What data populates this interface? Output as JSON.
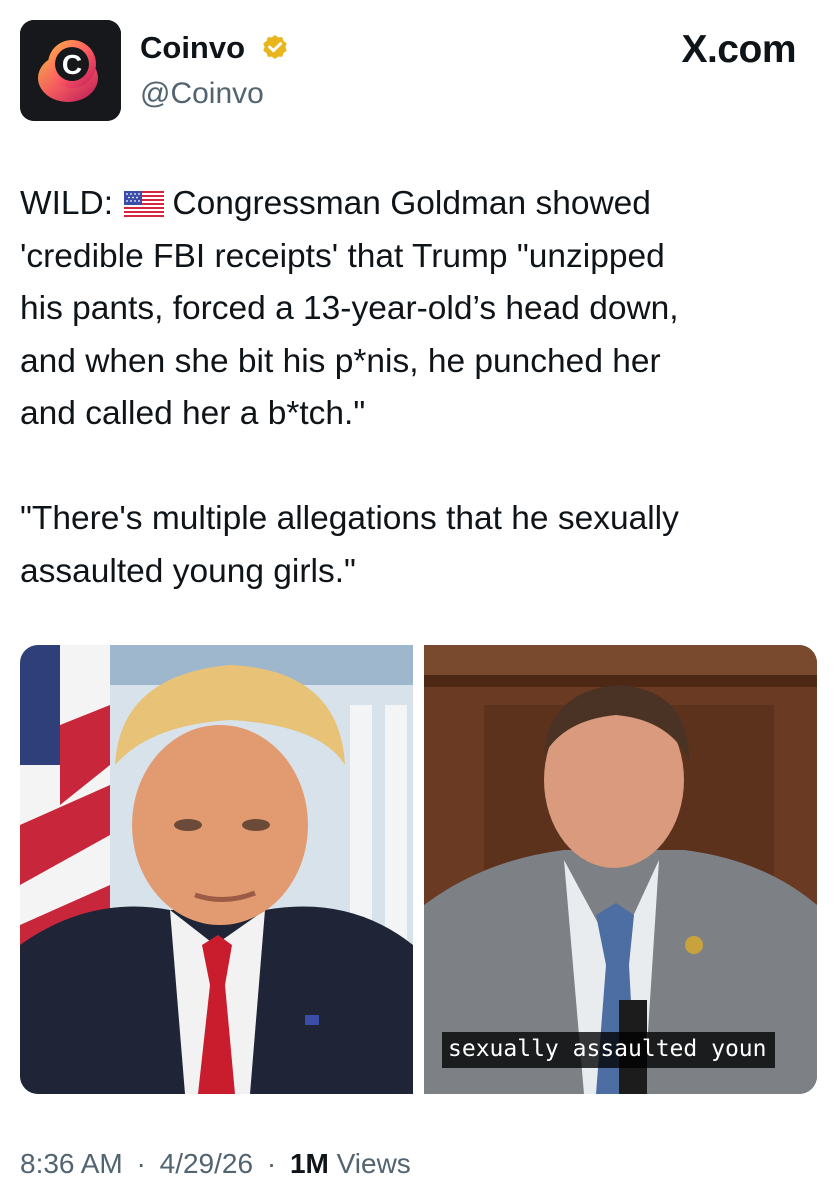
{
  "author": {
    "name": "Coinvo",
    "handle": "@Coinvo",
    "avatar_letter": "C",
    "verified_color": "#e8b51d"
  },
  "site_label": "X.com",
  "tweet": {
    "text_part1": "WILD: ",
    "flag_icon": "us-flag-icon",
    "text_part2": "Congressman Goldman showed\n'credible FBI receipts' that Trump \"unzipped\nhis pants, forced a 13-year-old’s head down,\nand when she bit his p*nis, he punched her\nand called her a b*tch.\"\n\n\"There's multiple allegations that he sexually\nassaulted young girls.\""
  },
  "media": {
    "right_caption": "sexually assaulted youn"
  },
  "meta": {
    "time": "8:36 AM",
    "date": "4/29/26",
    "separator": "·",
    "views_count": "1M",
    "views_label": "Views"
  }
}
